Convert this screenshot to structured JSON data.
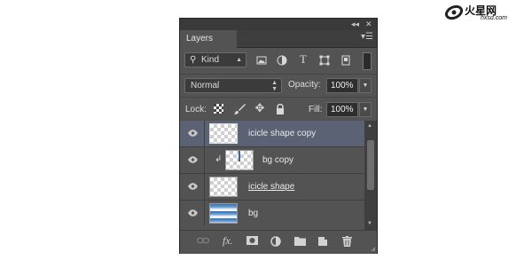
{
  "panel": {
    "tab_label": "Layers",
    "top_controls": {
      "collapse": "◂◂",
      "close": "✕"
    },
    "menu_icon": "☰"
  },
  "filter": {
    "kind_label": "Kind",
    "filter_icons": [
      "image-filter-icon",
      "adjustment-filter-icon",
      "type-filter-icon",
      "shape-filter-icon",
      "smartobject-filter-icon"
    ]
  },
  "blend": {
    "mode": "Normal",
    "opacity_label": "Opacity:",
    "opacity_value": "100%"
  },
  "lock": {
    "label": "Lock:",
    "fill_label": "Fill:",
    "fill_value": "100%"
  },
  "layers": [
    {
      "name": "icicle shape copy",
      "selected": true,
      "clipped": false,
      "thumb": "transparent"
    },
    {
      "name": "bg copy",
      "selected": false,
      "clipped": true,
      "thumb": "transparent"
    },
    {
      "name": "icicle shape",
      "selected": false,
      "clipped": false,
      "thumb": "transparent",
      "underlined": true
    },
    {
      "name": "bg",
      "selected": false,
      "clipped": false,
      "thumb": "sky"
    }
  ],
  "bottom_icons": [
    "link-icon",
    "fx-icon",
    "mask-icon",
    "adjustment-icon",
    "folder-icon",
    "new-layer-icon",
    "trash-icon"
  ],
  "watermark": {
    "text": "火星网",
    "subtext": "hxsd.com"
  }
}
